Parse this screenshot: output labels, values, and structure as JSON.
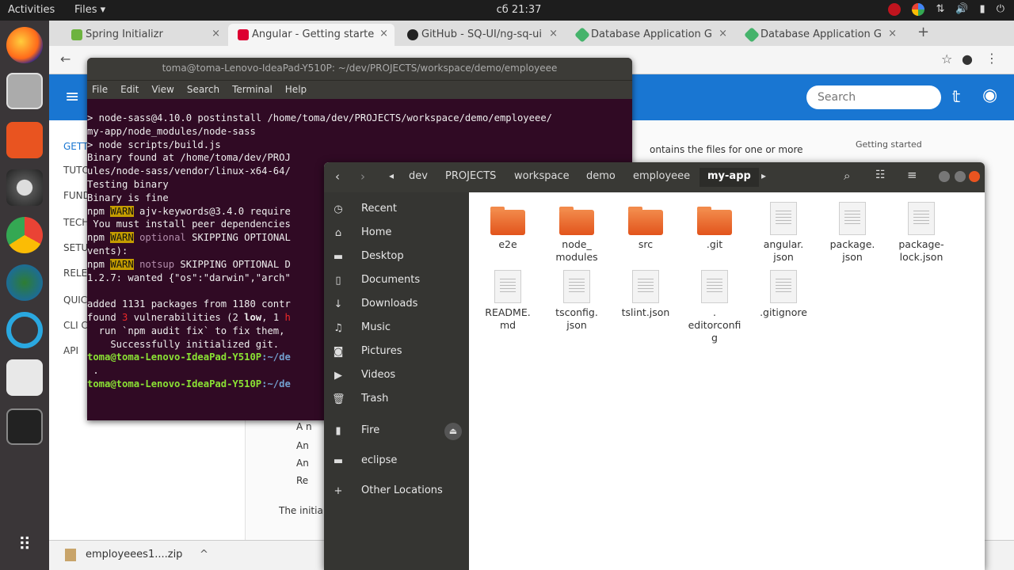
{
  "topbar": {
    "activities": "Activities",
    "app_menu": "Files ▾",
    "clock": "сб 21:37"
  },
  "browser": {
    "tabs": [
      {
        "label": "Spring Initializr",
        "color": "#6db33f"
      },
      {
        "label": "Angular - Getting starte",
        "color": "#dd0031"
      },
      {
        "label": "GitHub - SQ-UI/ng-sq-ui",
        "color": "#222222"
      },
      {
        "label": "Database Application G",
        "color": "#45b36b"
      },
      {
        "label": "Database Application G",
        "color": "#45b36b"
      }
    ],
    "new_tab": "+",
    "download": {
      "filename": "employeees1....zip",
      "caret": "^"
    }
  },
  "site": {
    "search_placeholder": "Search",
    "sidenav": [
      "GETT",
      "TUTO",
      "FUND",
      "TECH",
      "SETU",
      "RELE",
      "QUIC",
      "CLI C",
      "API"
    ],
    "toc_title": "Getting started",
    "content_snippet": "ontains the files for one or more",
    "bullets": [
      "A n",
      "An",
      "An",
      "Re"
    ],
    "initial_text": "The initia"
  },
  "terminal": {
    "title": "toma@toma-Lenovo-IdeaPad-Y510P: ~/dev/PROJECTS/workspace/demo/employeee",
    "menu": [
      "File",
      "Edit",
      "View",
      "Search",
      "Terminal",
      "Help"
    ],
    "lines": [
      "> node-sass@4.10.0 postinstall /home/toma/dev/PROJECTS/workspace/demo/employeee/",
      "my-app/node_modules/node-sass",
      "> node scripts/build.js",
      "",
      "Binary found at /home/toma/dev/PROJ",
      "ules/node-sass/vendor/linux-x64-64/",
      "Testing binary",
      "Binary is fine"
    ],
    "warn_tag": "WARN",
    "npm": "npm",
    "warn1": " ajv-keywords@3.4.0 require",
    "warn1b": " You must install peer dependencies",
    "optional": "optional",
    "warn2": " SKIPPING OPTIONAL",
    "events": "vents):",
    "notsup": "notsup",
    "warn3": " SKIPPING OPTIONAL D",
    "wanted": "1.2.7: wanted {\"os\":\"darwin\",\"arch\"",
    "added": "added 1131 packages from 1180 contr",
    "found_pre": "found ",
    "found_num": "3",
    "found_mid": " vulnerabilities (2 ",
    "found_low": "low",
    "found_post": ", 1 ",
    "found_h": "h",
    "audit": "  run `npm audit fix` to fix them,",
    "init": "    Successfully initialized git.",
    "prompt_user": "toma@toma-Lenovo-IdeaPad-Y510P",
    "prompt_path": ":~/de",
    "prompt_cont": " .",
    "prompt_user2": "toma@toma-Lenovo-IdeaPad-Y510P",
    "prompt_path2": ":~/de"
  },
  "files": {
    "breadcrumbs": [
      "dev",
      "PROJECTS",
      "workspace",
      "demo",
      "employeee",
      "my-app"
    ],
    "places": [
      "Recent",
      "Home",
      "Desktop",
      "Documents",
      "Downloads",
      "Music",
      "Pictures",
      "Videos",
      "Trash",
      "Fire",
      "eclipse",
      "Other Locations"
    ],
    "items": [
      {
        "name": "e2e",
        "kind": "folder"
      },
      {
        "name": "node_\nmodules",
        "kind": "folder"
      },
      {
        "name": "src",
        "kind": "folder"
      },
      {
        "name": ".git",
        "kind": "folder"
      },
      {
        "name": "angular.\njson",
        "kind": "file"
      },
      {
        "name": "package.\njson",
        "kind": "file"
      },
      {
        "name": "package-\nlock.json",
        "kind": "file"
      },
      {
        "name": "README.\nmd",
        "kind": "file"
      },
      {
        "name": "tsconfig.\njson",
        "kind": "file"
      },
      {
        "name": "tslint.json",
        "kind": "file"
      },
      {
        "name": ".\neditorconfi\ng",
        "kind": "file"
      },
      {
        "name": ".gitignore",
        "kind": "file"
      }
    ]
  }
}
